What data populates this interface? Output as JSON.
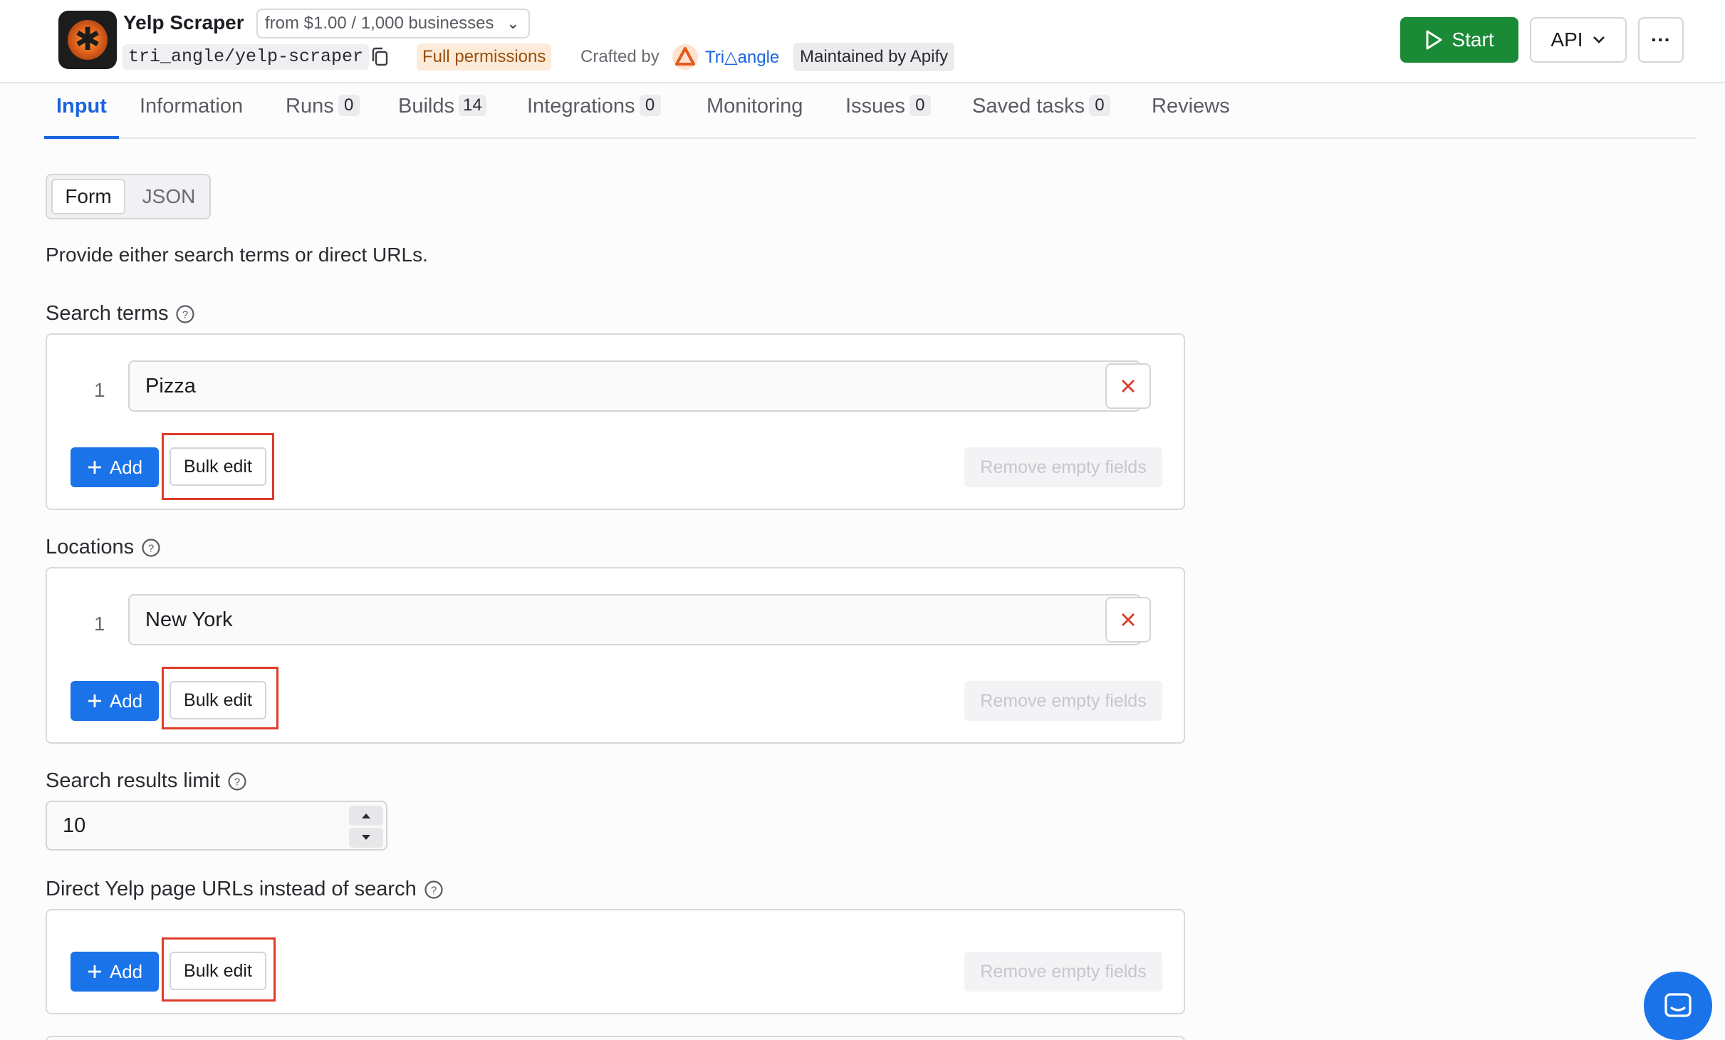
{
  "header": {
    "title": "Yelp Scraper",
    "pricing": "from $1.00 / 1,000 businesses",
    "slug": "tri_angle/yelp-scraper",
    "permissions": "Full permissions",
    "crafted_by": "Crafted by",
    "author": "Tri△angle",
    "maintained": "Maintained by Apify",
    "start_label": "Start",
    "api_label": "API",
    "more_label": "···"
  },
  "tabs": [
    {
      "label": "Input",
      "active": true
    },
    {
      "label": "Information"
    },
    {
      "label": "Runs",
      "count": "0"
    },
    {
      "label": "Builds",
      "count": "14"
    },
    {
      "label": "Integrations",
      "count": "0"
    },
    {
      "label": "Monitoring"
    },
    {
      "label": "Issues",
      "count": "0"
    },
    {
      "label": "Saved tasks",
      "count": "0"
    },
    {
      "label": "Reviews"
    }
  ],
  "mode": {
    "form": "Form",
    "json": "JSON",
    "selected": "Form"
  },
  "intro": "Provide either search terms or direct URLs.",
  "fields": {
    "search_terms": {
      "label": "Search terms",
      "rows": [
        {
          "num": "1",
          "value": "Pizza"
        }
      ]
    },
    "locations": {
      "label": "Locations",
      "rows": [
        {
          "num": "1",
          "value": "New York"
        }
      ]
    },
    "search_limit": {
      "label": "Search results limit",
      "value": "10"
    },
    "direct_urls": {
      "label": "Direct Yelp page URLs instead of search",
      "rows": []
    }
  },
  "buttons": {
    "add": "Add",
    "bulk_edit": "Bulk edit",
    "remove_empty": "Remove empty fields"
  },
  "colors": {
    "accent": "#1a73e8",
    "start": "#1b8a36",
    "highlight": "#e03b2a",
    "remove_x": "#d93b2a"
  }
}
